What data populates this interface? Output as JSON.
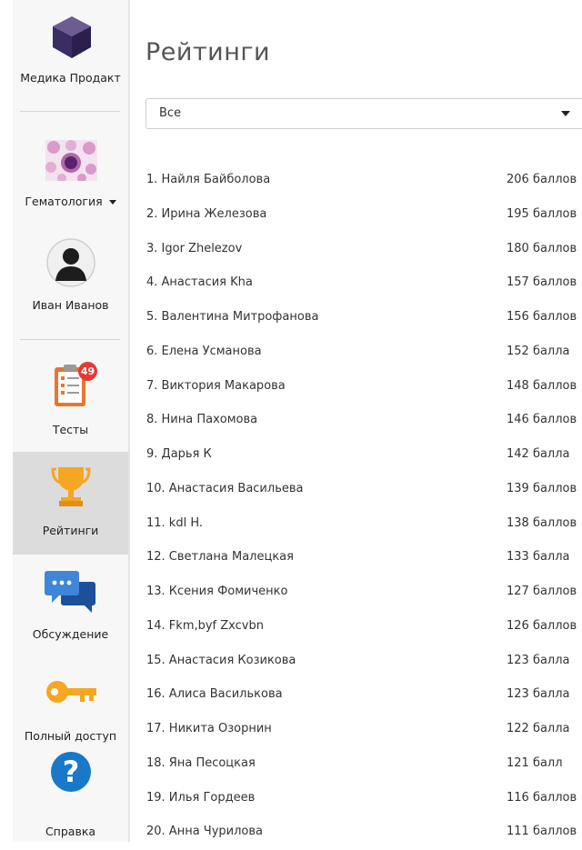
{
  "sidebar": {
    "brand": "Медика Продакт",
    "specialty": "Гематология",
    "user": "Иван Иванов",
    "tests_label": "Тесты",
    "tests_badge": "49",
    "ratings_label": "Рейтинги",
    "discussion_label": "Обсуждение",
    "access_label": "Полный доступ",
    "help_label": "Справка"
  },
  "main": {
    "title": "Рейтинги",
    "filter": {
      "selected": "Все"
    },
    "ratings": [
      {
        "name": "1. Найля Байболова",
        "score": "206 баллов"
      },
      {
        "name": "2. Ирина Железова",
        "score": "195 баллов"
      },
      {
        "name": "3. Igor Zhelezov",
        "score": "180 баллов"
      },
      {
        "name": "4. Анастасия Kha",
        "score": "157 баллов"
      },
      {
        "name": "5. Валентина Митрофанова",
        "score": "156 баллов"
      },
      {
        "name": "6. Елена Усманова",
        "score": "152 балла"
      },
      {
        "name": "7. Виктория Макарова",
        "score": "148 баллов"
      },
      {
        "name": "8. Нина Пахомова",
        "score": "146 баллов"
      },
      {
        "name": "9. Дарья К",
        "score": "142 балла"
      },
      {
        "name": "10. Анастасия Васильева",
        "score": "139 баллов"
      },
      {
        "name": "11. kdl H.",
        "score": "138 баллов"
      },
      {
        "name": "12. Светлана Малецкая",
        "score": "133 балла"
      },
      {
        "name": "13. Ксения Фомиченко",
        "score": "127 баллов"
      },
      {
        "name": "14. Fkm,byf Zxcvbn",
        "score": "126 баллов"
      },
      {
        "name": "15. Анастасия Козикова",
        "score": "123 балла"
      },
      {
        "name": "16. Алиса Василькова",
        "score": "123 балла"
      },
      {
        "name": "17. Никита Озорнин",
        "score": "122 балла"
      },
      {
        "name": "18. Яна Песоцкая",
        "score": "121 балл"
      },
      {
        "name": "19. Илья Гордеев",
        "score": "116 баллов"
      },
      {
        "name": "20. Анна Чурилова",
        "score": "111 баллов"
      }
    ]
  },
  "colors": {
    "accent_orange": "#f5a623",
    "chat_blue": "#1e63b5",
    "help_blue": "#1a78c9",
    "badge_red": "#e53935",
    "logo_purple": "#3a2d63"
  },
  "icons": [
    "cube-logo-icon",
    "hematology-cells-icon",
    "user-avatar-icon",
    "checklist-icon",
    "trophy-icon",
    "chat-bubbles-icon",
    "key-icon",
    "question-icon",
    "caret-down-icon"
  ]
}
